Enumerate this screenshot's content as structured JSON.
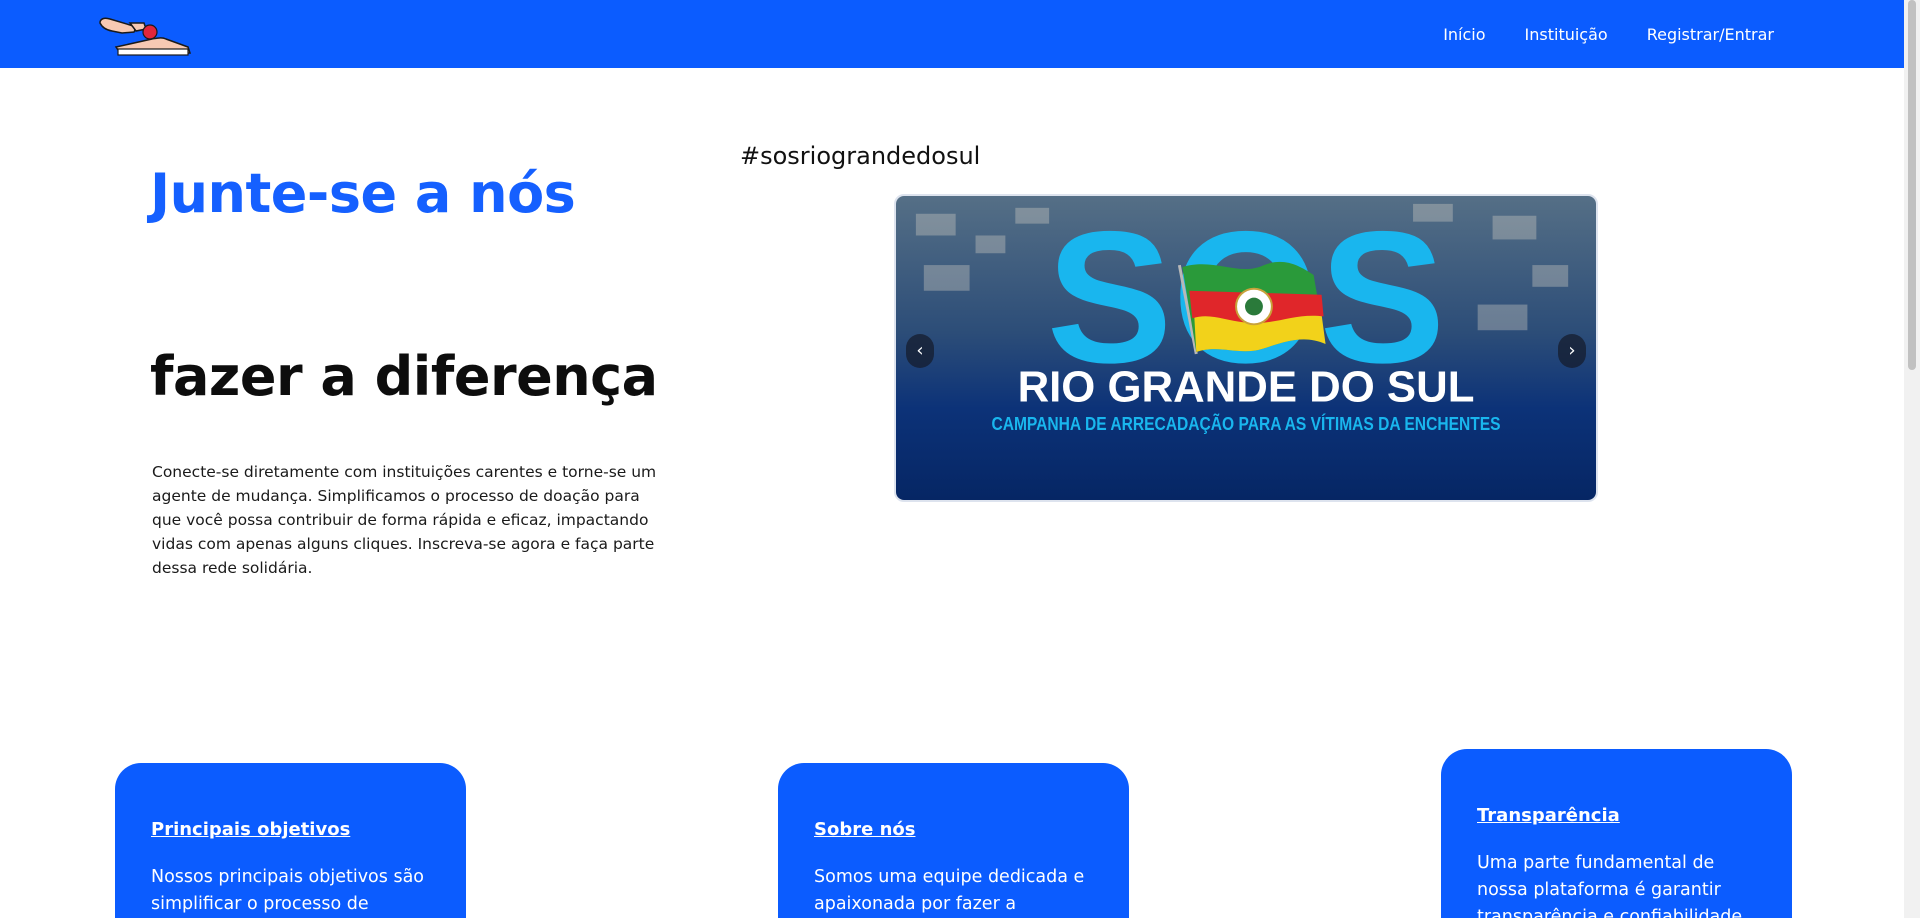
{
  "nav": {
    "links": [
      "Início",
      "Instituição",
      "Registrar/Entrar"
    ]
  },
  "hero": {
    "title": "Junte-se a nós",
    "subtitle": "fazer a diferença",
    "description": "Conecte-se diretamente com instituições carentes e torne-se um agente de mudança. Simplificamos o processo de doação para que você possa contribuir de forma rápida e eficaz, impactando vidas com apenas alguns cliques. Inscreva-se agora e faça parte dessa rede solidária."
  },
  "campaign": {
    "hashtag": "#sosriograndedosul",
    "banner_big": "SOS",
    "banner_title": "RIO GRANDE DO SUL",
    "banner_subtitle": "CAMPANHA DE ARRECADAÇÃO PARA AS VÍTIMAS DA ENCHENTES",
    "prev_label": "‹",
    "next_label": "›"
  },
  "cards": [
    {
      "title": "Principais objetivos",
      "text": "Nossos principais objetivos são simplificar o processo de"
    },
    {
      "title": "Sobre nós",
      "text": "Somos uma equipe dedicada e apaixonada por fazer a"
    },
    {
      "title": "Transparência",
      "text": "Uma parte fundamental de nossa plataforma é garantir transparência e confiabilidade"
    }
  ],
  "colors": {
    "brand": "#0b5cff",
    "title_blue": "#1560ff",
    "banner_navy": "#0a2f6e",
    "banner_cyan": "#19b6ee"
  }
}
